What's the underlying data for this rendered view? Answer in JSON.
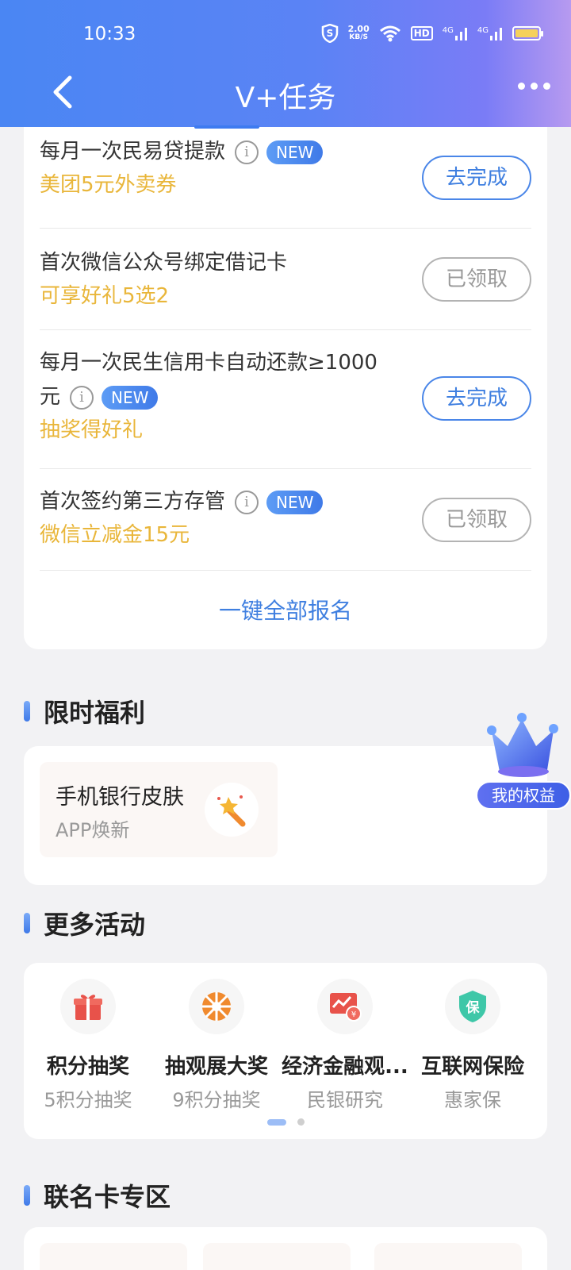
{
  "status_bar": {
    "time": "10:33",
    "net_speed_value": "2.00",
    "net_speed_unit": "KB/S",
    "hd_label": "HD",
    "sig1": "4G",
    "sig2": "4G"
  },
  "nav": {
    "title": "V+任务"
  },
  "tasks": [
    {
      "name": "每月一次民易贷提款",
      "reward": "美团5元外卖券",
      "new": "NEW",
      "action": "去完成"
    },
    {
      "name": "首次微信公众号绑定借记卡",
      "reward": "可享好礼5选2",
      "action": "已领取"
    },
    {
      "name_line1": "每月一次民生信用卡自动还款≥1000",
      "name_line2": "元",
      "reward": "抽奖得好礼",
      "new": "NEW",
      "action": "去完成"
    },
    {
      "name": "首次签约第三方存管",
      "reward": "微信立减金15元",
      "new": "NEW",
      "action": "已领取"
    }
  ],
  "enroll_all": "一键全部报名",
  "welfare": {
    "section_title": "限时福利",
    "item_title": "手机银行皮肤",
    "item_sub": "APP焕新"
  },
  "crown_badge": "我的权益",
  "activities": {
    "section_title": "更多活动",
    "items": [
      {
        "name": "积分抽奖",
        "sub": "5积分抽奖",
        "icon": "gift-icon"
      },
      {
        "name": "抽观展大奖",
        "sub": "9积分抽奖",
        "icon": "wheel-icon"
      },
      {
        "name": "经济金融观...",
        "sub": "民银研究",
        "icon": "chart-icon"
      },
      {
        "name": "互联网保险",
        "sub": "惠家保",
        "icon": "shield-icon",
        "icon_text": "保"
      }
    ]
  },
  "cobrand": {
    "section_title": "联名卡专区"
  },
  "colors": {
    "accent": "#3f7fe0",
    "reward": "#e9b63a",
    "header_start": "#4a86f3",
    "header_end": "#b79af0"
  }
}
